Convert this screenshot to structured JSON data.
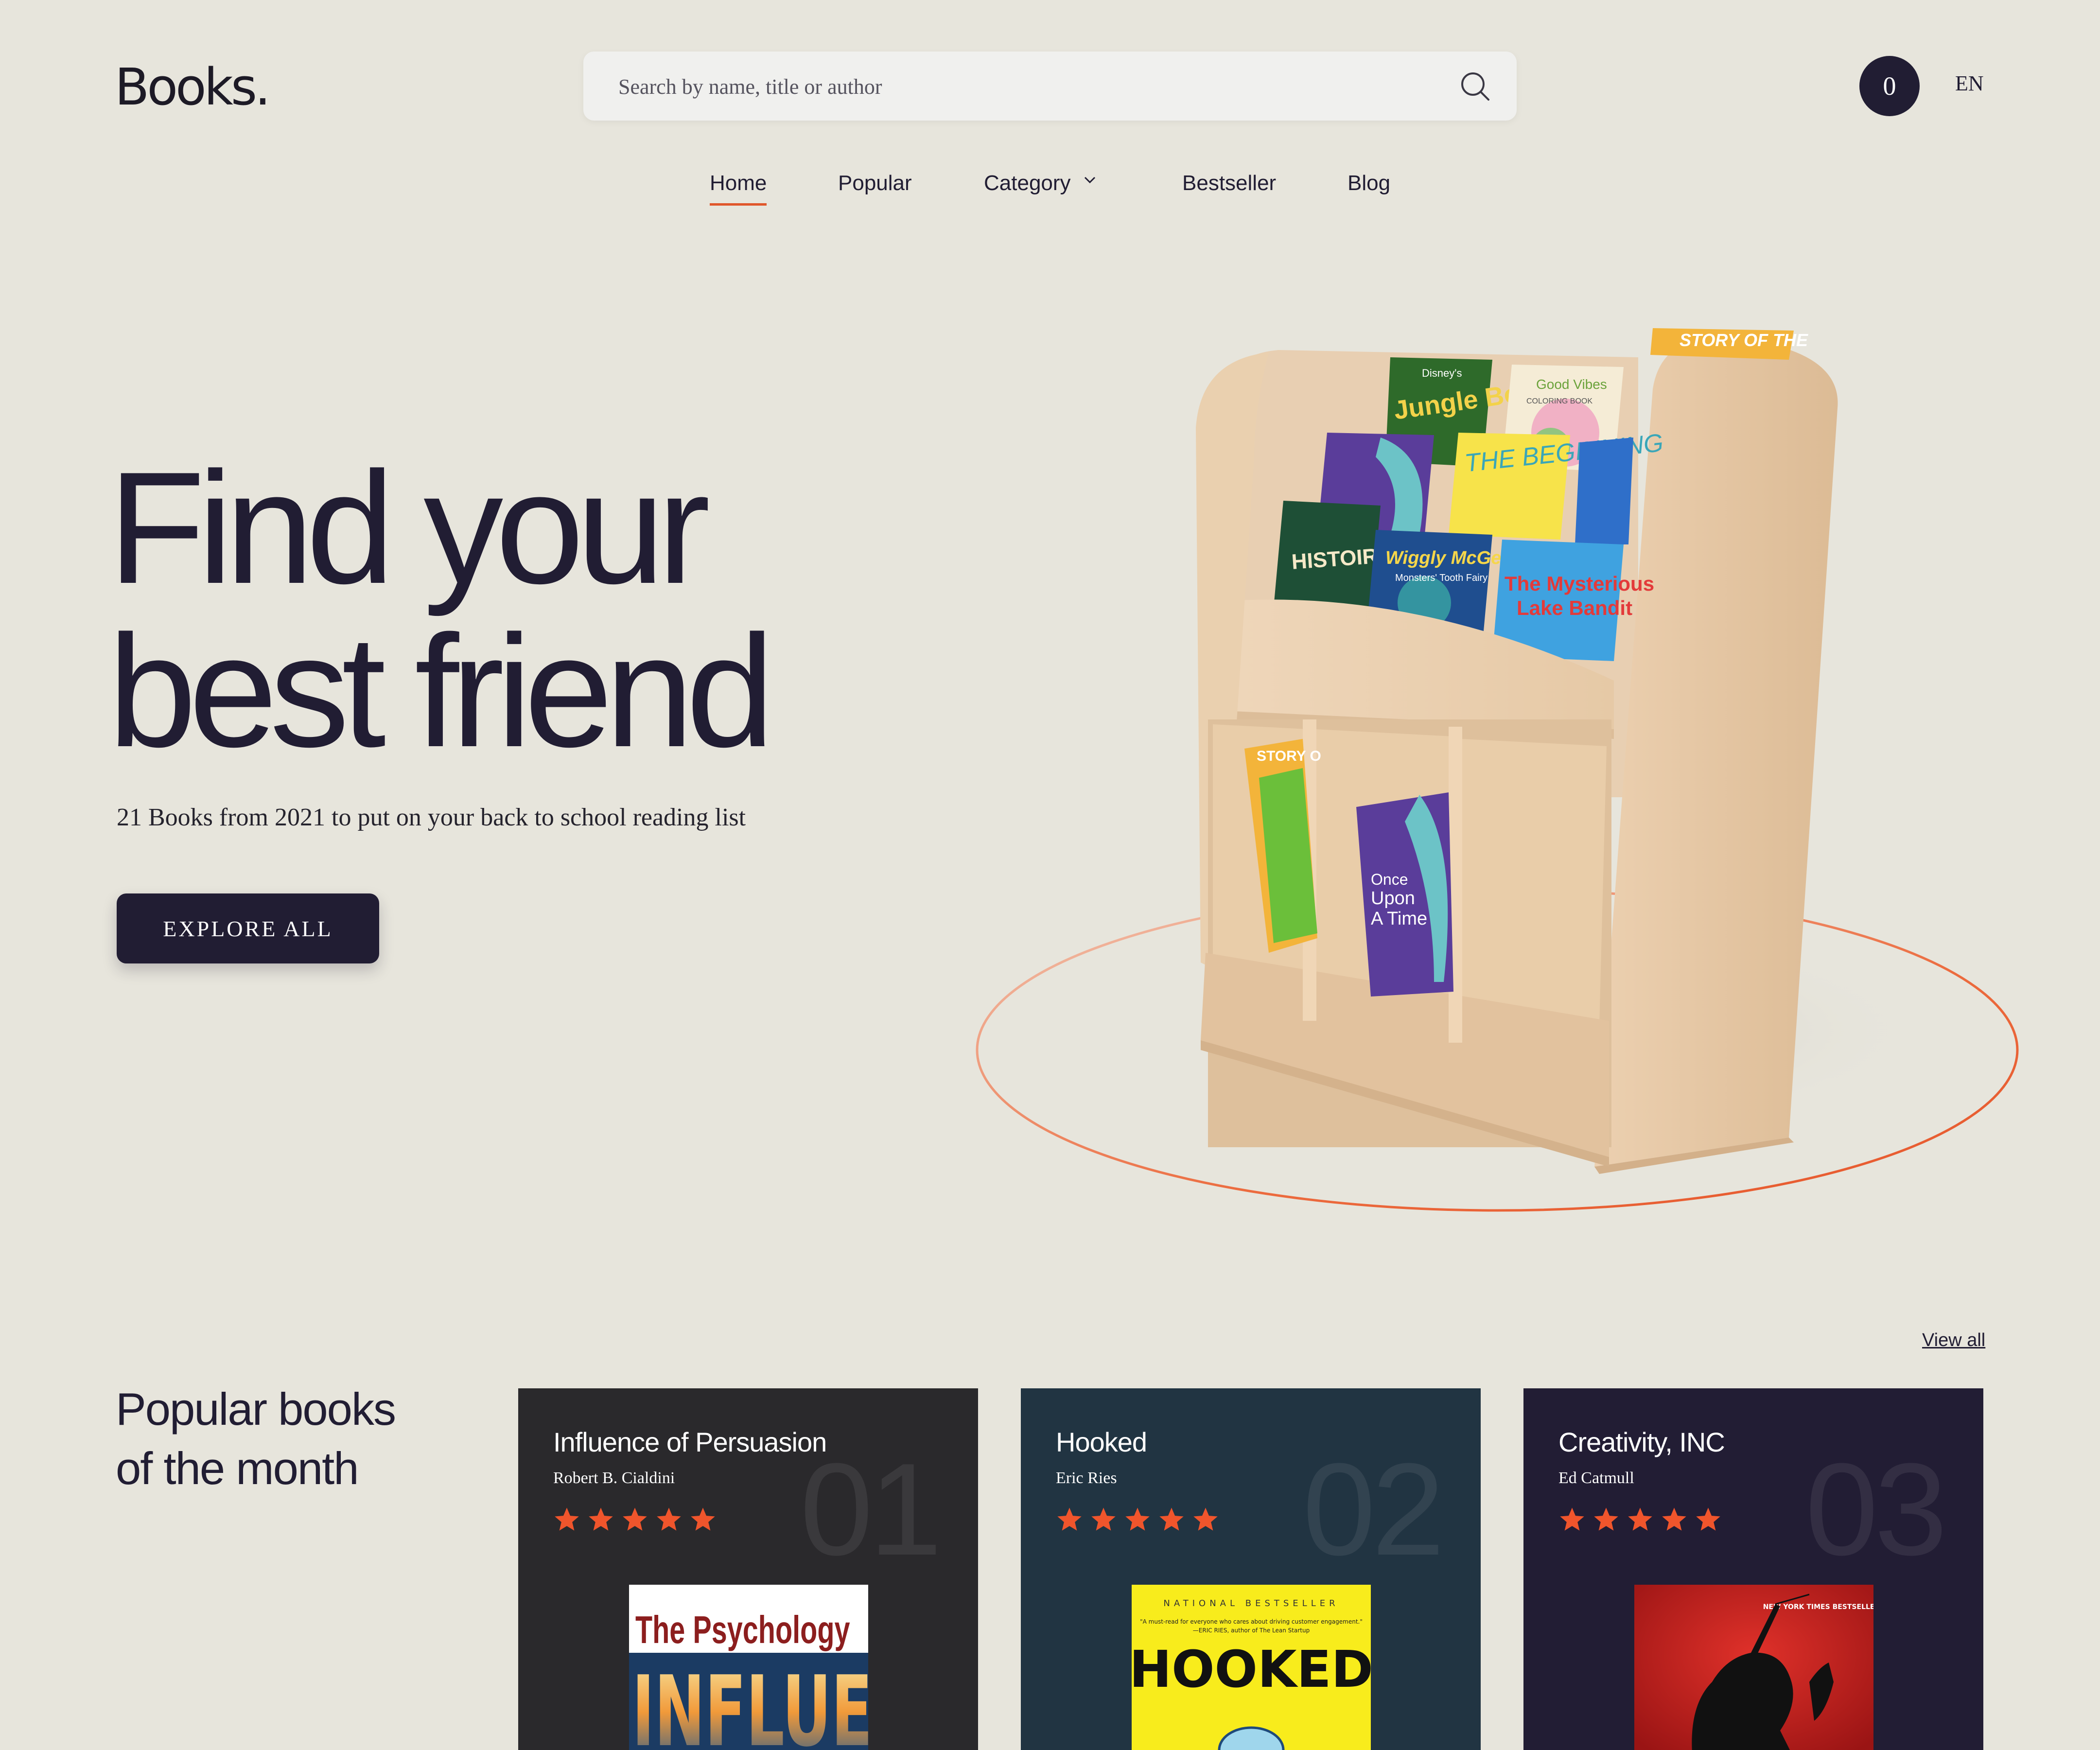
{
  "brand": {
    "logo": "Books."
  },
  "search": {
    "placeholder": "Search by name, title or author"
  },
  "header": {
    "cart_count": "0",
    "language": "EN"
  },
  "nav": {
    "items": [
      "Home",
      "Popular",
      "Category",
      "Bestseller",
      "Blog"
    ],
    "active": "Home"
  },
  "hero": {
    "title_line1": "Find your",
    "title_line2": "best friend",
    "subtitle": "21 Books from 2021 to put on your back to school reading list",
    "cta": "EXPLORE ALL"
  },
  "shelf_books": {
    "top_right": "STORY OF THE",
    "jungle_brand": "Disney's",
    "jungle": "Jungle Book",
    "good_vibes": "Good Vibes",
    "good_vibes_sub": "COLORING BOOK",
    "beginning": "THE BEGINNING",
    "histoire": "HISTOIRES",
    "wiggly": "Wiggly McGee",
    "wiggly_sub": "Monsters' Tooth Fairy",
    "lake_line1": "The Mysterious",
    "lake_line2": "Lake Bandit",
    "once_line1": "Once",
    "once_line2": "Upon",
    "once_line3": "A Time",
    "story_lower": "STORY O"
  },
  "popular": {
    "heading_line1": "Popular books",
    "heading_line2": "of the month",
    "view_all": "View all",
    "books": [
      {
        "rank": "01",
        "title": "Influence of Persuasion",
        "author": "Robert B. Cialdini",
        "rating": 5,
        "cover_line1": "The Psychology",
        "cover_line2": "INFLUENCE",
        "bg": "#2a292c"
      },
      {
        "rank": "02",
        "title": "Hooked",
        "author": "Eric Ries",
        "rating": 5,
        "cover_top": "NATIONAL BESTSELLER",
        "cover_quote": "\"A must-read for everyone who cares about driving customer engagement.\"",
        "cover_quote_by": "—ERIC RIES, author of The Lean Startup",
        "cover_title": "HOOKED",
        "bg": "#213442"
      },
      {
        "rank": "03",
        "title": "Creativity, INC",
        "author": "Ed Catmull",
        "rating": 5,
        "cover_top": "NEW YORK TIMES BESTSELLER",
        "bg": "#221d34"
      }
    ]
  },
  "colors": {
    "background": "#e7e5dc",
    "ink": "#211d33",
    "accent": "#e0572b",
    "star": "#f0552c"
  },
  "icons": [
    "search-icon",
    "chevron-down-icon",
    "star-icon"
  ]
}
